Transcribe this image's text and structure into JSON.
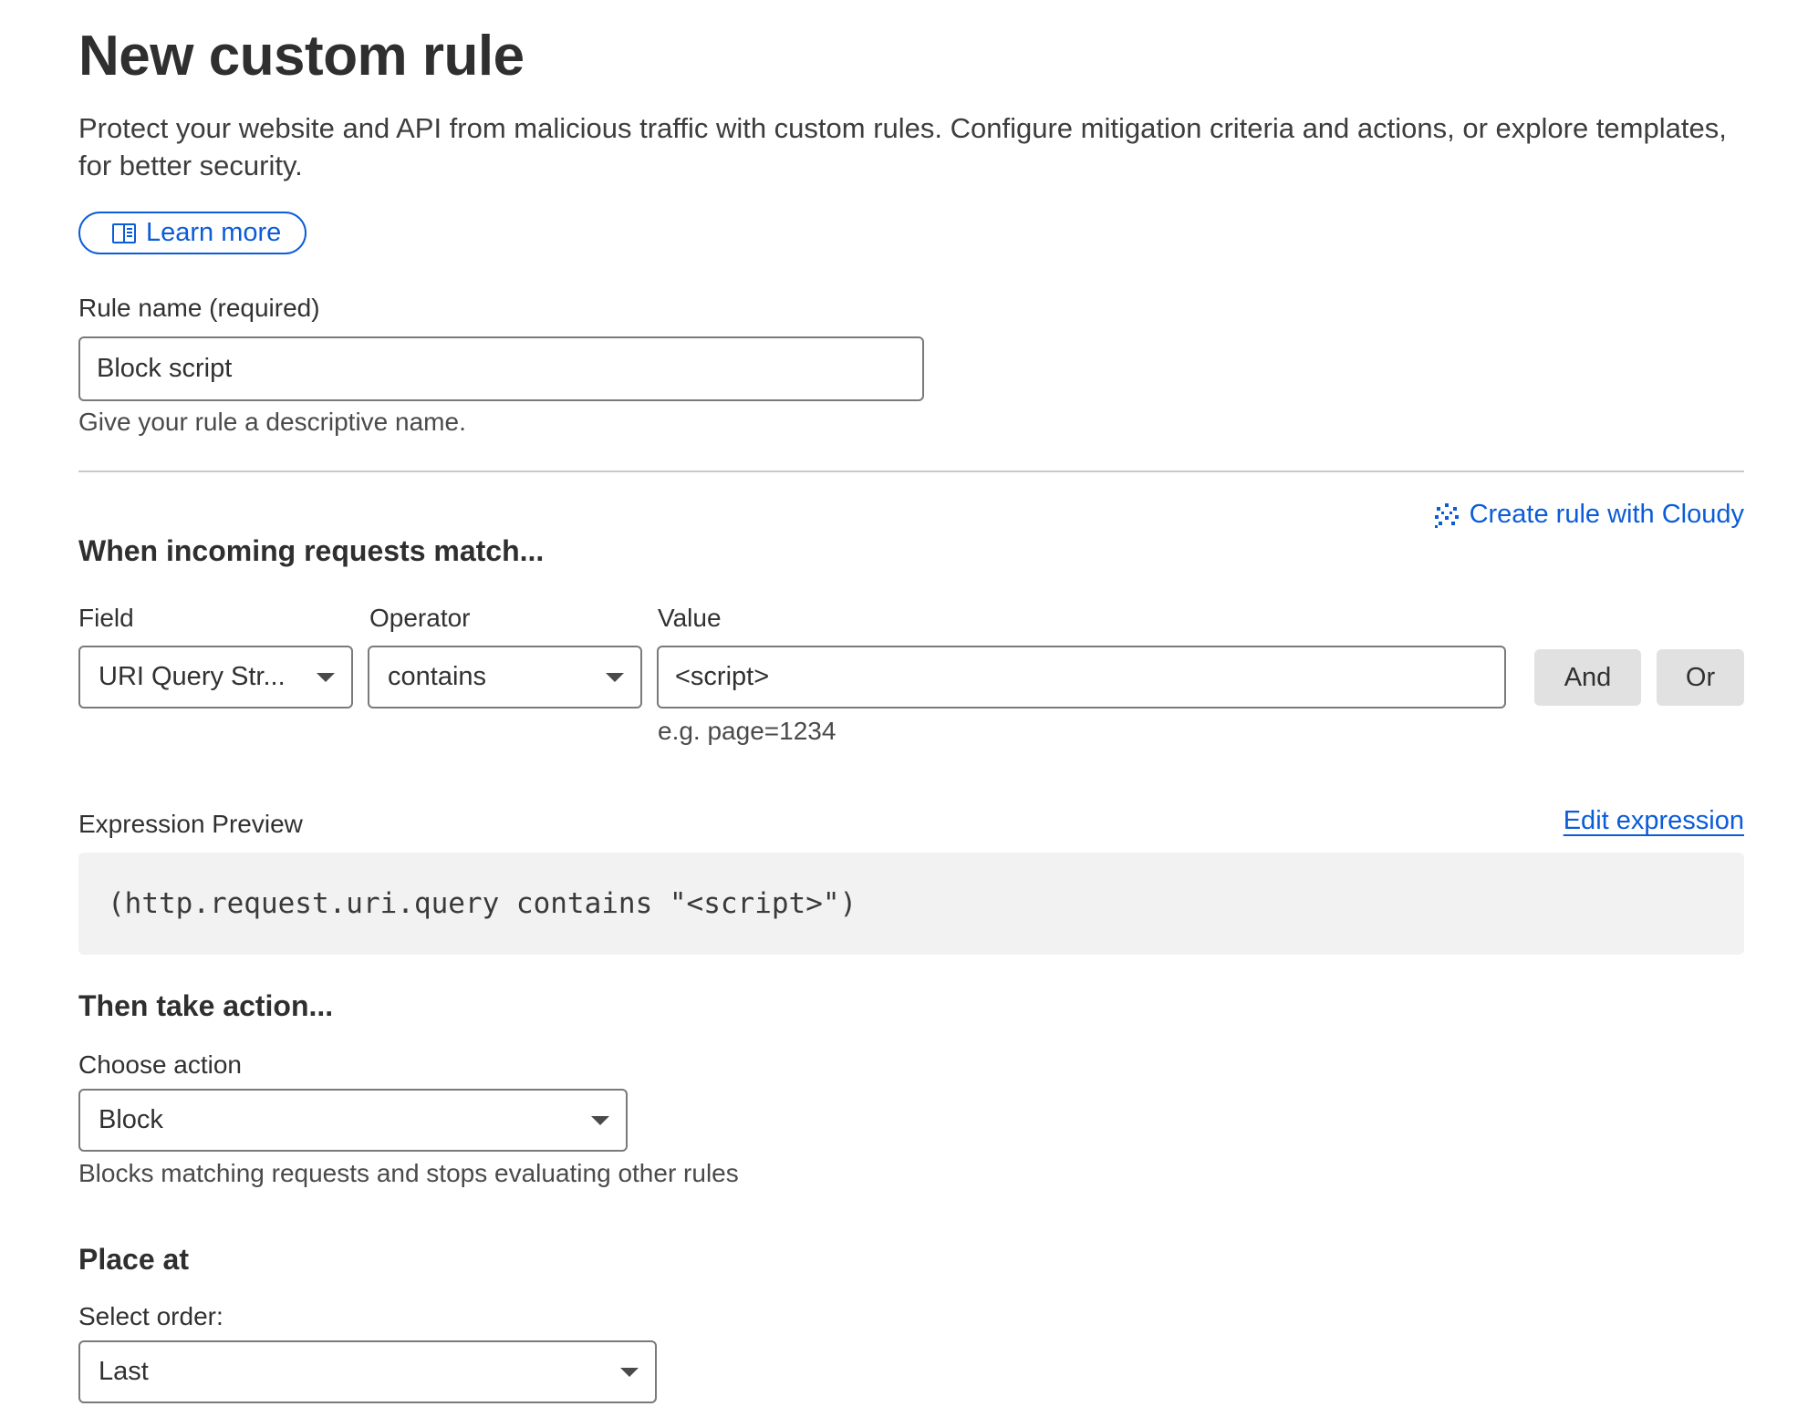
{
  "header": {
    "title": "New custom rule",
    "description": "Protect your website and API from malicious traffic with custom rules. Configure mitigation criteria and actions, or explore templates, for better security.",
    "learn_more_label": "Learn more"
  },
  "rule_name": {
    "label": "Rule name (required)",
    "value": "Block script",
    "helper": "Give your rule a descriptive name."
  },
  "match": {
    "heading": "When incoming requests match...",
    "cloudy_label": "Create rule with Cloudy",
    "field_label": "Field",
    "field_value": "URI Query Str...",
    "operator_label": "Operator",
    "operator_value": "contains",
    "value_label": "Value",
    "value_value": "<script>",
    "value_helper": "e.g. page=1234",
    "and_label": "And",
    "or_label": "Or"
  },
  "expression": {
    "label": "Expression Preview",
    "edit_label": "Edit expression",
    "code": "(http.request.uri.query contains \"<script>\")"
  },
  "action": {
    "heading": "Then take action...",
    "label": "Choose action",
    "value": "Block",
    "helper": "Blocks matching requests and stops evaluating other rules"
  },
  "placement": {
    "heading": "Place at",
    "label": "Select order:",
    "value": "Last"
  },
  "colors": {
    "link": "#0b5cd8",
    "border": "#7a7a7a",
    "code_bg": "#f2f2f2",
    "button_bg": "#e1e1e1"
  }
}
